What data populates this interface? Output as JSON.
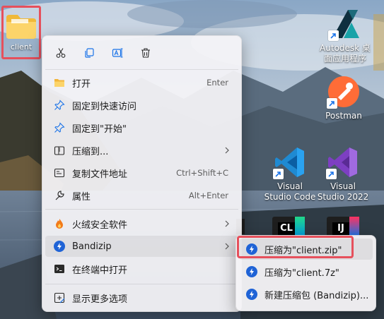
{
  "desktop": {
    "icons": [
      {
        "label": "client",
        "icon": "folder-icon"
      },
      {
        "label": "Autodesk 桌面应用程序",
        "line1": "Autodesk 桌",
        "line2": "面应用程序",
        "icon": "autodesk-icon"
      },
      {
        "label": "Postman",
        "icon": "postman-icon"
      },
      {
        "label": "Visual Studio Code",
        "line1": "Visual",
        "line2": "Studio Code",
        "icon": "vscode-icon"
      },
      {
        "label": "Visual Studio 2022",
        "line1": "Visual",
        "line2": "Studio 2022",
        "icon": "visual-studio-icon"
      }
    ]
  },
  "menu": {
    "quick_actions": [
      "cut-icon",
      "copy-icon",
      "rename-icon",
      "delete-icon"
    ],
    "items": [
      {
        "label": "打开",
        "shortcut": "Enter",
        "icon": "folder-open-icon"
      },
      {
        "label": "固定到快速访问",
        "icon": "pin-icon"
      },
      {
        "label": "固定到\"开始\"",
        "icon": "pin-start-icon"
      },
      {
        "label": "压缩到...",
        "icon": "compress-icon",
        "submenu": true
      },
      {
        "label": "复制文件地址",
        "shortcut": "Ctrl+Shift+C",
        "icon": "copy-path-icon"
      },
      {
        "label": "属性",
        "shortcut": "Alt+Enter",
        "icon": "properties-icon"
      },
      {
        "label": "火绒安全软件",
        "icon": "huorong-icon",
        "submenu": true
      },
      {
        "label": "Bandizip",
        "icon": "bandizip-icon",
        "submenu": true
      },
      {
        "label": "在终端中打开",
        "icon": "terminal-icon"
      },
      {
        "label": "显示更多选项",
        "icon": "more-options-icon"
      }
    ]
  },
  "submenu": {
    "items": [
      {
        "label": "压缩为\"client.zip\"",
        "icon": "bandizip-icon"
      },
      {
        "label": "压缩为\"client.7z\"",
        "icon": "bandizip-icon"
      },
      {
        "label": "新建压缩包 (Bandizip)...",
        "icon": "bandizip-icon"
      }
    ]
  },
  "colors": {
    "highlight_border": "#e6505c",
    "bandizip_blue": "#1f63d6",
    "accent_blue": "#1a73e8"
  }
}
